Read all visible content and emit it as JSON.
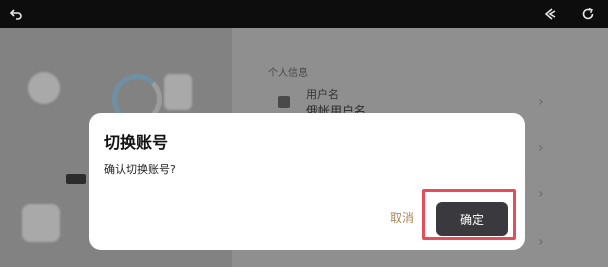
{
  "topbar": {
    "back_icon": "undo-arrow-icon",
    "right_icons": [
      "collapse-arrow-icon",
      "refresh-icon"
    ]
  },
  "background": {
    "section_title": "个人信息",
    "row_label": "用户名",
    "row_value": "俄帐用户名"
  },
  "dialog": {
    "title": "切换账号",
    "message": "确认切换账号?",
    "cancel_label": "取消",
    "confirm_label": "确定"
  },
  "colors": {
    "accent_highlight": "#e84b5a",
    "cancel_text": "#a8895c",
    "confirm_bg": "#3a3a3e"
  }
}
